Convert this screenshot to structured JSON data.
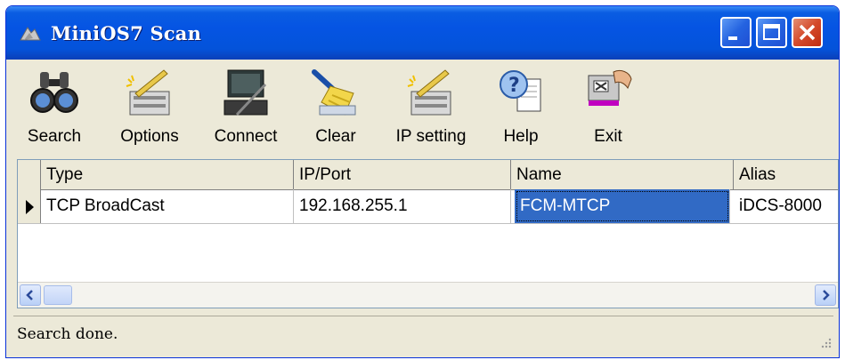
{
  "window": {
    "title": "MiniOS7 Scan",
    "controls": [
      "minimize",
      "maximize",
      "close"
    ]
  },
  "toolbar": {
    "buttons": [
      {
        "label": "Search",
        "icon": "binoculars-icon"
      },
      {
        "label": "Options",
        "icon": "options-icon"
      },
      {
        "label": "Connect",
        "icon": "connect-icon"
      },
      {
        "label": "Clear",
        "icon": "broom-icon"
      },
      {
        "label": "IP setting",
        "icon": "ip-setting-icon"
      },
      {
        "label": "Help",
        "icon": "help-icon"
      },
      {
        "label": "Exit",
        "icon": "exit-icon"
      }
    ]
  },
  "grid": {
    "columns": [
      "Type",
      "IP/Port",
      "Name",
      "Alias"
    ],
    "rows": [
      {
        "type": "TCP BroadCast",
        "ip_port": "192.168.255.1",
        "name": "FCM-MTCP",
        "alias": "iDCS-8000"
      }
    ],
    "selected_cell": "name"
  },
  "status": {
    "text": "Search done."
  },
  "colors": {
    "title_bar": "#0554e3",
    "selection": "#316ac5",
    "window_bg": "#ece9d8"
  }
}
